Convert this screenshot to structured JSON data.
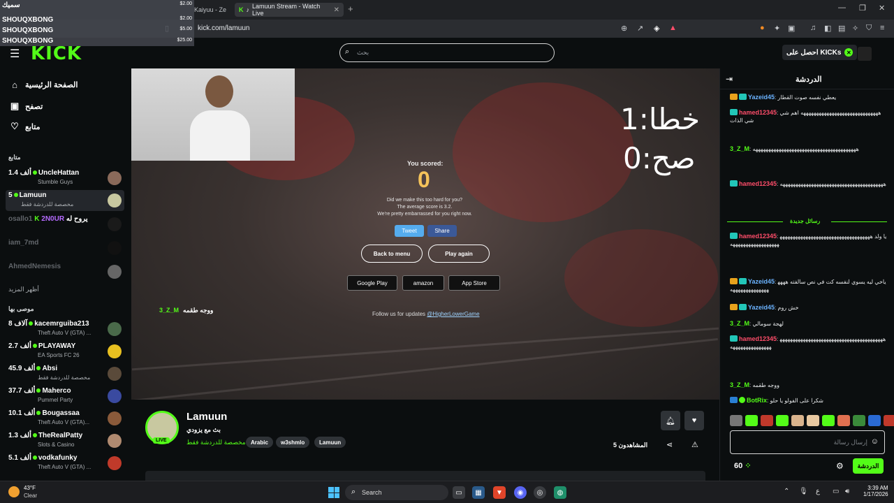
{
  "browser": {
    "tabs": [
      {
        "label": "Kaiyuu - Ze"
      },
      {
        "label": "Lamuun Stream - Watch Live"
      }
    ],
    "url": "kick.com/lamuun"
  },
  "donations": [
    {
      "name": "سميك",
      "amount": "$2.00"
    },
    {
      "name": "SHOUQXBONG",
      "amount": "$2.00"
    },
    {
      "name": "SHOUQXBONG",
      "amount": "$5.00"
    },
    {
      "name": "SHOUQXBONG",
      "amount": "$25.00"
    }
  ],
  "header": {
    "logo": "KICK",
    "search_placeholder": "بحث",
    "get_kicks": "احصل على KICKs"
  },
  "sidebar": {
    "nav": [
      {
        "label": "الصفحة الرئيسية",
        "icon": "home-icon"
      },
      {
        "label": "تصفح",
        "icon": "browse-icon"
      },
      {
        "label": "متابع",
        "icon": "heart-icon"
      }
    ],
    "following_title": "متابع",
    "following": [
      {
        "count": "1.4 ألف",
        "name": "UncleHattan",
        "sub": "Stumble Guys",
        "live": true
      },
      {
        "count": "5",
        "name": "Lamuun",
        "sub": "مخصصة للدردشة فقط",
        "live": true
      },
      {
        "count": "",
        "name": "osallo1",
        "sub": "",
        "live": false
      },
      {
        "count": "",
        "name": "iam_7md",
        "sub": "",
        "live": false
      },
      {
        "count": "",
        "name": "AhmedNemesis",
        "sub": "",
        "live": false
      }
    ],
    "raid": {
      "prefix": "K",
      "name": "2N0UR",
      "text": "يروح له"
    },
    "show_more": "أظهر المزيد",
    "recommended_title": "موصى بها",
    "recommended": [
      {
        "count": "8 آلاف",
        "name": "kacemrguiba213",
        "sub": "Theft Auto V (GTA) ..."
      },
      {
        "count": "2.7 ألف",
        "name": "PLAYAWAY",
        "sub": "EA Sports FC 26"
      },
      {
        "count": "45.9 ألف",
        "name": "Absi",
        "sub": "مخصصة للدردشة فقط"
      },
      {
        "count": "37.7 ألف",
        "name": "Maherco",
        "sub": "Pummel Party"
      },
      {
        "count": "10.1 ألف",
        "name": "Bougassaa",
        "sub": "Theft Auto V (GTA)..."
      },
      {
        "count": "1.3 ألف",
        "name": "TheRealPatty",
        "sub": "Slots & Casino"
      },
      {
        "count": "5.1 ألف",
        "name": "vodkafunky",
        "sub": "Theft Auto V (GTA) ..."
      }
    ]
  },
  "video": {
    "overlay_line1": "خطا:1",
    "overlay_line2": "صح:0",
    "game": {
      "you_scored": "You scored:",
      "score": "0",
      "msg1": "Did we make this too hard for you?",
      "msg2": "The average score is 3.2.",
      "msg3": "We're pretty embarrassed for you right now.",
      "tweet": "Tweet",
      "share": "Share",
      "back": "Back to menu",
      "play": "Play again",
      "store1": "Google Play",
      "store2": "amazon",
      "store3": "App Store",
      "follow": "Follow us for updates",
      "handle": "@HigherLowerGame"
    },
    "caption_user": "3_Z_M",
    "caption_text": "ووجه طقمه"
  },
  "stream": {
    "name": "Lamuun",
    "title": "بث مع يزودي",
    "category": "مخصصة للدردشة فقط",
    "live": "LIVE",
    "tags": [
      "Arabic",
      "w3shmlo",
      "Lamuun"
    ],
    "viewers": "5 المشاهدون"
  },
  "chat": {
    "title": "الدردشة",
    "messages": [
      {
        "badges": [
          "gold",
          "teal"
        ],
        "user": "Yazeid45",
        "color": "#6bb3ff",
        "text": "يعطي نفسه صوت القطار"
      },
      {
        "badges": [
          "teal"
        ],
        "user": "hamed12345",
        "color": "#ff4d6a",
        "text": "ههههههههههههههههههههههههههههههه اهم شي شي الذات"
      },
      {
        "badges": [],
        "user": "3_Z_M",
        "color": "#53fc18",
        "text": "ههههههههههههههههههههههههههههههههههههههههه"
      },
      {
        "badges": [
          "teal"
        ],
        "user": "hamed12345",
        "color": "#ff4d6a",
        "text": "ههههههههههههههههههههههههههههههههههههههههه"
      },
      {
        "badges": [
          "teal"
        ],
        "user": "hamed12345",
        "color": "#ff4d6a",
        "text": "يا ولد ههههههههههههههههههههههههههههههههههههههههههههههههههههههه"
      },
      {
        "badges": [
          "gold",
          "teal"
        ],
        "user": "Yazeid45",
        "color": "#6bb3ff",
        "text": "ياخي ليه يسوي لنفسه كت في نص سالفته ههههههههههههههههههه"
      },
      {
        "badges": [
          "gold",
          "teal"
        ],
        "user": "Yazeid45",
        "color": "#6bb3ff",
        "text": "خش روم"
      },
      {
        "badges": [],
        "user": "3_Z_M",
        "color": "#53fc18",
        "text": "لهجة سومالي"
      },
      {
        "badges": [
          "teal"
        ],
        "user": "hamed12345",
        "color": "#ff4d6a",
        "text": "ههههههههههههههههههههههههههههههههههههههههههههههههههههههههه"
      },
      {
        "badges": [],
        "user": "3_Z_M",
        "color": "#53fc18",
        "text": "ووجه طقمه"
      },
      {
        "badges": [
          "bot"
        ],
        "user": "BotRix",
        "color": "#53fc18",
        "text": "شكرا على الفولو يا حلو"
      }
    ],
    "new_messages": "رسائل جديدة",
    "input_placeholder": "إرسال رسالة",
    "points": "60",
    "send": "الدردشة"
  },
  "taskbar": {
    "temp": "43°F",
    "cond": "Clear",
    "search": "Search",
    "time": "3:39 AM",
    "date": "1/17/2026"
  }
}
